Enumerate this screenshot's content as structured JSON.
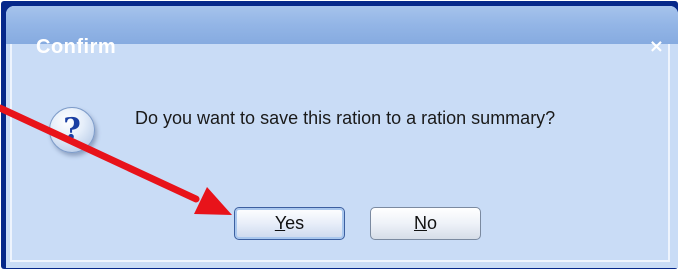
{
  "dialog": {
    "title": "Confirm",
    "close_label": "×",
    "icon": "question-icon",
    "message": "Do you want to save this ration to a ration summary?"
  },
  "buttons": {
    "yes": {
      "mnemonic": "Y",
      "rest": "es"
    },
    "no": {
      "mnemonic": "N",
      "rest": "o"
    }
  },
  "annotation": {
    "arrow_color": "#e8131a"
  }
}
